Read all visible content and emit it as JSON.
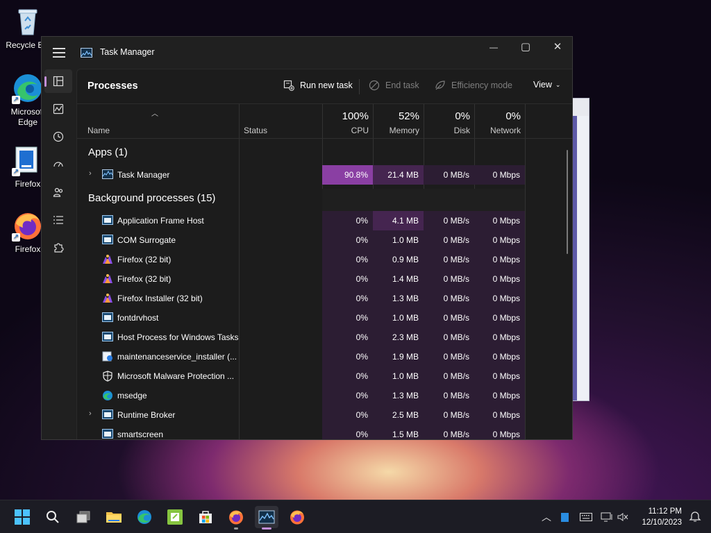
{
  "desktop": {
    "icons": [
      {
        "label": "Recycle Bin",
        "icon": "recycle-bin-icon"
      },
      {
        "label": "Microsoft Edge",
        "icon": "edge-icon"
      },
      {
        "label": "Firefox",
        "icon": "firefox-installer-icon"
      },
      {
        "label": "Firefox",
        "icon": "firefox-icon"
      }
    ]
  },
  "window": {
    "title": "Task Manager",
    "minimize": "—",
    "maximize": "▢",
    "close": "✕"
  },
  "toolbar": {
    "page_title": "Processes",
    "run_new_task": "Run new task",
    "end_task": "End task",
    "efficiency_mode": "Efficiency mode",
    "view": "View"
  },
  "columns": {
    "name": "Name",
    "status": "Status",
    "cpu_pct": "100%",
    "cpu": "CPU",
    "memory_pct": "52%",
    "memory": "Memory",
    "disk_pct": "0%",
    "disk": "Disk",
    "network_pct": "0%",
    "network": "Network"
  },
  "groups": {
    "apps": "Apps (1)",
    "background": "Background processes (15)"
  },
  "apps": [
    {
      "name": "Task Manager",
      "cpu": "90.8%",
      "memory": "21.4 MB",
      "disk": "0 MB/s",
      "network": "0 Mbps",
      "icon": "task-manager-icon",
      "expandable": true
    }
  ],
  "processes": [
    {
      "name": "Application Frame Host",
      "cpu": "0%",
      "memory": "4.1 MB",
      "disk": "0 MB/s",
      "network": "0 Mbps",
      "icon": "window-icon"
    },
    {
      "name": "COM Surrogate",
      "cpu": "0%",
      "memory": "1.0 MB",
      "disk": "0 MB/s",
      "network": "0 Mbps",
      "icon": "window-icon"
    },
    {
      "name": "Firefox (32 bit)",
      "cpu": "0%",
      "memory": "0.9 MB",
      "disk": "0 MB/s",
      "network": "0 Mbps",
      "icon": "firefox-icon"
    },
    {
      "name": "Firefox (32 bit)",
      "cpu": "0%",
      "memory": "1.4 MB",
      "disk": "0 MB/s",
      "network": "0 Mbps",
      "icon": "firefox-icon"
    },
    {
      "name": "Firefox Installer (32 bit)",
      "cpu": "0%",
      "memory": "1.3 MB",
      "disk": "0 MB/s",
      "network": "0 Mbps",
      "icon": "firefox-icon"
    },
    {
      "name": "fontdrvhost",
      "cpu": "0%",
      "memory": "1.0 MB",
      "disk": "0 MB/s",
      "network": "0 Mbps",
      "icon": "window-icon"
    },
    {
      "name": "Host Process for Windows Tasks",
      "cpu": "0%",
      "memory": "2.3 MB",
      "disk": "0 MB/s",
      "network": "0 Mbps",
      "icon": "window-icon"
    },
    {
      "name": "maintenanceservice_installer (...",
      "cpu": "0%",
      "memory": "1.9 MB",
      "disk": "0 MB/s",
      "network": "0 Mbps",
      "icon": "installer-icon"
    },
    {
      "name": "Microsoft Malware Protection ...",
      "cpu": "0%",
      "memory": "1.0 MB",
      "disk": "0 MB/s",
      "network": "0 Mbps",
      "icon": "shield-icon"
    },
    {
      "name": "msedge",
      "cpu": "0%",
      "memory": "1.3 MB",
      "disk": "0 MB/s",
      "network": "0 Mbps",
      "icon": "edge-icon"
    },
    {
      "name": "Runtime Broker",
      "cpu": "0%",
      "memory": "2.5 MB",
      "disk": "0 MB/s",
      "network": "0 Mbps",
      "icon": "window-icon",
      "expandable": true
    },
    {
      "name": "smartscreen",
      "cpu": "0%",
      "memory": "1.5 MB",
      "disk": "0 MB/s",
      "network": "0 Mbps",
      "icon": "window-icon"
    }
  ],
  "taskbar": {
    "clock_time": "11:12 PM",
    "clock_date": "12/10/2023"
  },
  "colors": {
    "cpu_highlight": "#8a3fa3",
    "heat_low": "#2c1d33",
    "heat_mid": "#452550",
    "accent": "#c38fd8"
  }
}
